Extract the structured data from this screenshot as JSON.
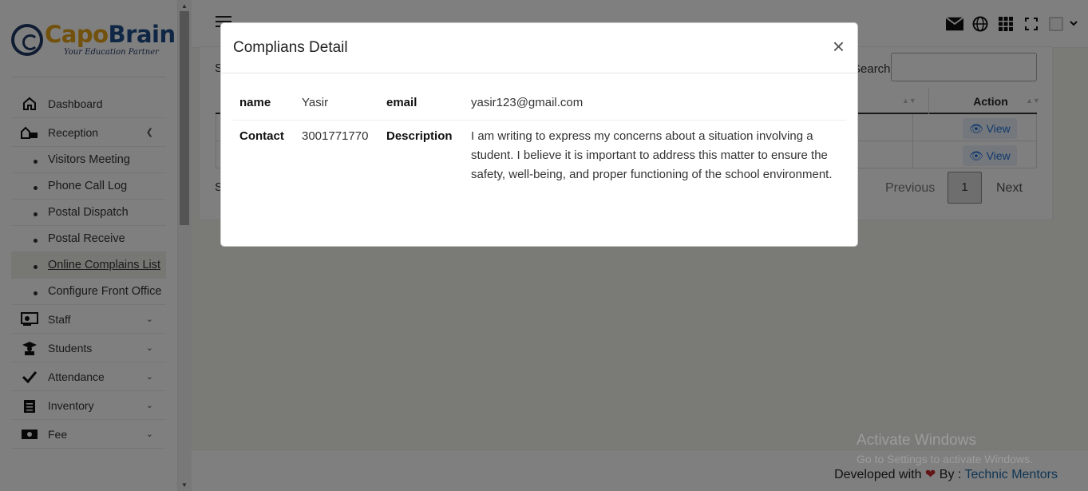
{
  "brand": {
    "name_part1": "Capo",
    "name_part2": "Brain",
    "tagline": "Your Education Partner"
  },
  "sidebar": {
    "items": [
      {
        "label": "Dashboard",
        "icon": "home-icon"
      },
      {
        "label": "Reception",
        "icon": "reception-icon"
      }
    ],
    "reception_sub": [
      {
        "label": "Visitors Meeting"
      },
      {
        "label": "Phone Call Log"
      },
      {
        "label": "Postal Dispatch"
      },
      {
        "label": "Postal Receive"
      },
      {
        "label": "Online Complains List"
      },
      {
        "label": "Configure Front Office"
      }
    ],
    "items_after": [
      {
        "label": "Staff",
        "icon": "staff-icon"
      },
      {
        "label": "Students",
        "icon": "student-icon"
      },
      {
        "label": "Attendance",
        "icon": "check-icon"
      },
      {
        "label": "Inventory",
        "icon": "clipboard-icon"
      },
      {
        "label": "Fee",
        "icon": "money-icon"
      }
    ]
  },
  "background_table": {
    "search_label": "Search:",
    "action_header": "Action",
    "view_label": "View",
    "pagination": {
      "previous": "Previous",
      "page": "1",
      "next": "Next"
    }
  },
  "modal": {
    "title": "Complians Detail",
    "close": "×",
    "fields": {
      "name_label": "name",
      "name_value": "Yasir",
      "email_label": "email",
      "email_value": "yasir123@gmail.com",
      "contact_label": "Contact",
      "contact_value": "3001771770",
      "description_label": "Description",
      "description_value": "I am writing to express my concerns about a situation involving a student. I believe it is important to address this matter to ensure the safety, well-being, and proper functioning of the school environment."
    }
  },
  "footer": {
    "prefix": "Developed with",
    "by": "By :",
    "company": "Technic Mentors"
  },
  "watermark": {
    "title": "Activate Windows",
    "subtitle": "Go to Settings to activate Windows."
  },
  "colors": {
    "brand_gold": "#e4a21b",
    "brand_navy": "#1f4e8a",
    "link": "#1f6aa8",
    "heart": "#c62828"
  }
}
